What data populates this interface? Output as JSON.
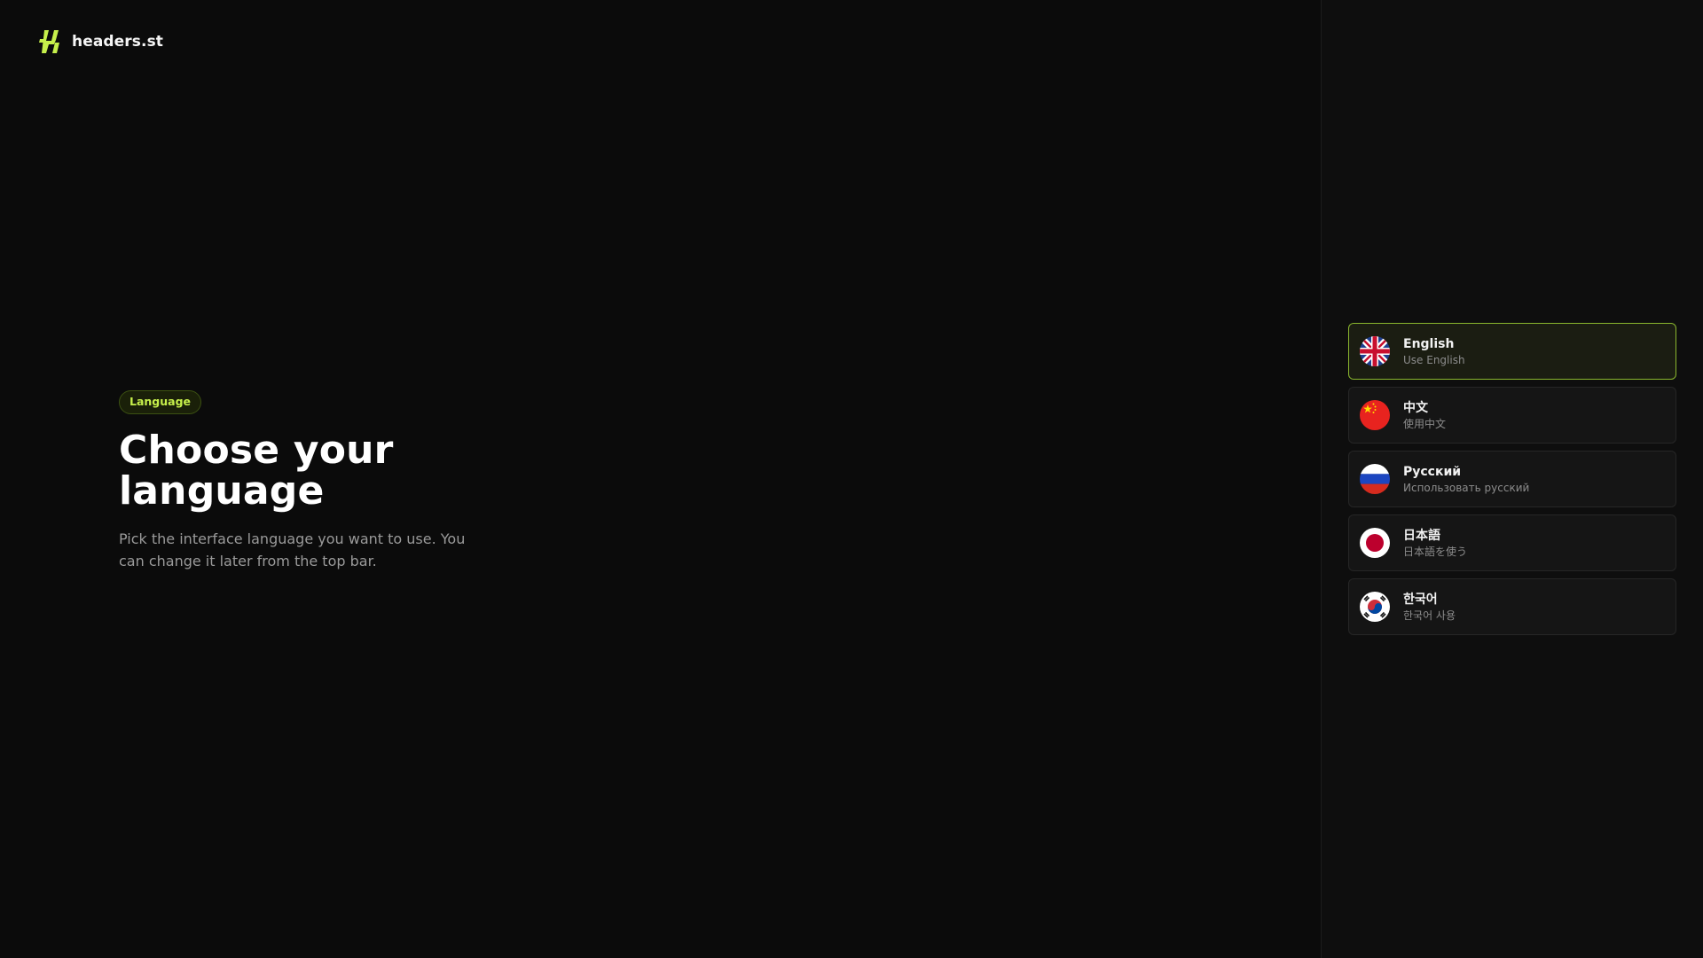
{
  "brand": {
    "name": "headers.st",
    "icon": "brand-logo-icon",
    "accent": "#c6ef4b"
  },
  "hero": {
    "badge": "Language",
    "title": "Choose your language",
    "description": "Pick the interface language you want to use. You can change it later from the top bar."
  },
  "languages": [
    {
      "name": "English",
      "subtitle": "Use English",
      "flag": "uk-flag-icon",
      "selected": true
    },
    {
      "name": "中文",
      "subtitle": "使用中文",
      "flag": "china-flag-icon",
      "selected": false
    },
    {
      "name": "Русский",
      "subtitle": "Использовать русский",
      "flag": "russia-flag-icon",
      "selected": false
    },
    {
      "name": "日本語",
      "subtitle": "日本語を使う",
      "flag": "japan-flag-icon",
      "selected": false
    },
    {
      "name": "한국어",
      "subtitle": "한국어 사용",
      "flag": "korea-flag-icon",
      "selected": false
    }
  ],
  "colors": {
    "background": "#0b0b0b",
    "selected_border": "#8ab62e"
  }
}
